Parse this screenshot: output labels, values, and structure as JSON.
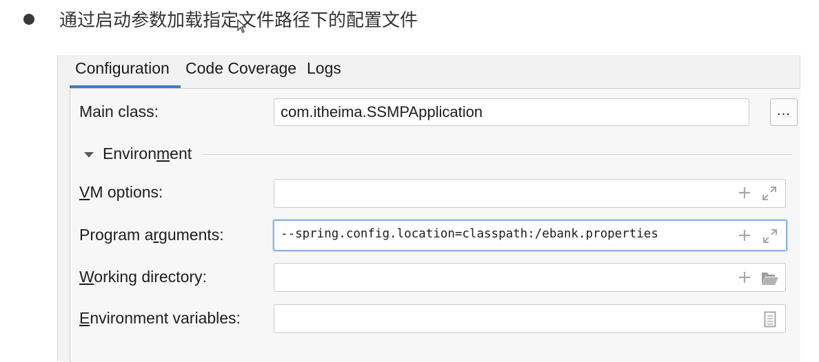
{
  "heading": {
    "text": "通过启动参数加载指定文件路径下的配置文件"
  },
  "tabs": [
    {
      "label": "Configuration",
      "selected": true
    },
    {
      "label": "Code Coverage",
      "selected": false
    },
    {
      "label": "Logs",
      "selected": false
    }
  ],
  "form": {
    "main_class": {
      "label": "Main class:",
      "value": "com.itheima.SSMPApplication",
      "browse_label": "..."
    },
    "environment_section": {
      "label_pre": "Environ",
      "label_mnemonic": "m",
      "label_post": "ent",
      "expanded": true
    },
    "vm_options": {
      "label_mnemonic": "V",
      "label_rest": "M options:",
      "value": ""
    },
    "program_arguments": {
      "label_pre": "Program a",
      "label_mnemonic": "r",
      "label_post": "guments:",
      "value": "--spring.config.location=classpath:/ebank.properties"
    },
    "working_directory": {
      "label_mnemonic": "W",
      "label_rest": "orking directory:",
      "value": ""
    },
    "environment_variables": {
      "label_mnemonic": "E",
      "label_rest": "nvironment variables:",
      "value": ""
    }
  },
  "icons": {
    "bullet": "bullet-dot",
    "cursor": "mouse-cursor-icon",
    "add": "plus-icon",
    "expand": "expand-icon",
    "folder": "folder-icon",
    "edit_env": "document-list-icon"
  },
  "colors": {
    "tab_accent": "#3d7bc6",
    "focus_border": "#8ab4e8",
    "panel_bg": "#f2f2f2"
  }
}
